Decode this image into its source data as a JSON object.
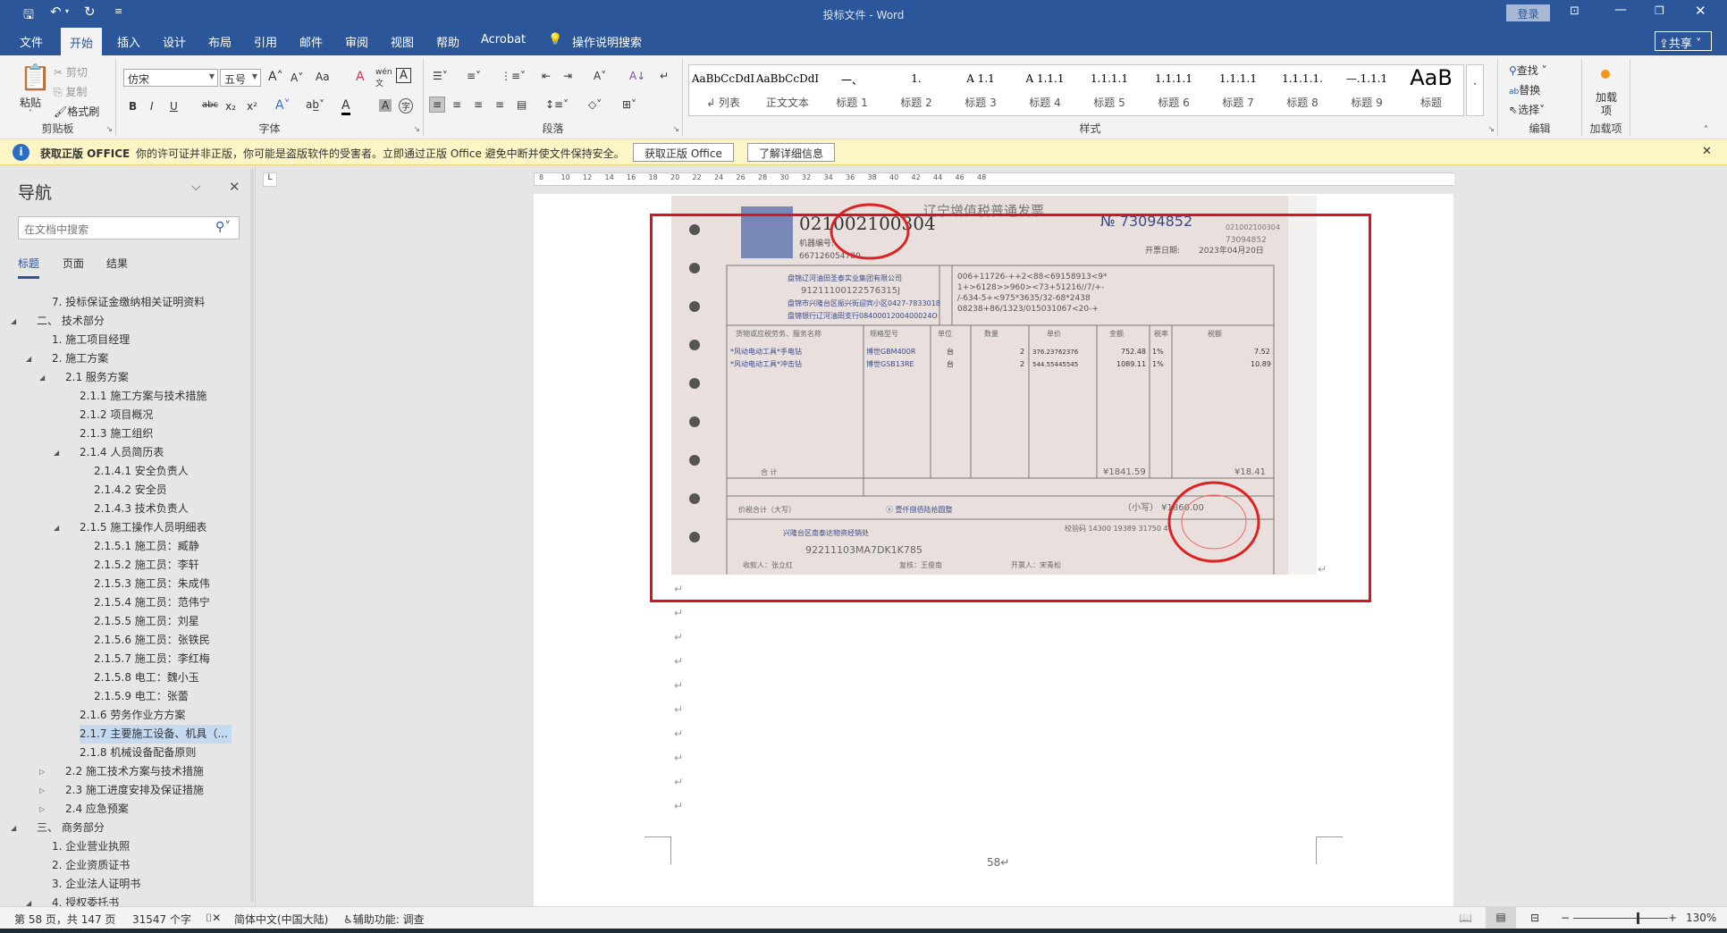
{
  "titlebar": {
    "title": "投标文件 - Word",
    "login": "登录",
    "qat": {
      "save": "save-icon",
      "undo": "undo-icon",
      "redo": "redo-icon",
      "customize": "customize-icon"
    }
  },
  "tabs": [
    "文件",
    "开始",
    "插入",
    "设计",
    "布局",
    "引用",
    "邮件",
    "审阅",
    "视图",
    "帮助",
    "Acrobat"
  ],
  "active_tab": "开始",
  "tell_me": "操作说明搜索",
  "share": "共享",
  "ribbon": {
    "clipboard": {
      "label": "剪贴板",
      "paste": "粘贴",
      "cut": "剪切",
      "copy": "复制",
      "format_painter": "格式刷"
    },
    "font": {
      "label": "字体",
      "font_name": "仿宋",
      "font_size": "五号",
      "case": "Aa",
      "bold": "B",
      "italic": "I",
      "underline": "U",
      "strike": "abc",
      "sub": "x₂",
      "sup": "x²"
    },
    "paragraph": {
      "label": "段落"
    },
    "styles": {
      "label": "样式",
      "items": [
        {
          "preview": "AaBbCcDdI",
          "name": "↲ 列表"
        },
        {
          "preview": "AaBbCcDdI",
          "name": "正文文本"
        },
        {
          "preview": "一、",
          "name": "标题 1"
        },
        {
          "preview": "1.",
          "name": "标题 2"
        },
        {
          "preview": "A 1.1",
          "name": "标题 3"
        },
        {
          "preview": "A 1.1.1",
          "name": "标题 4"
        },
        {
          "preview": "1.1.1.1",
          "name": "标题 5"
        },
        {
          "preview": "1.1.1.1",
          "name": "标题 6"
        },
        {
          "preview": "1.1.1.1",
          "name": "标题 7"
        },
        {
          "preview": "1.1.1.1.",
          "name": "标题 8"
        },
        {
          "preview": "—.1.1.1",
          "name": "标题 9"
        },
        {
          "preview": "AaB",
          "name": "标题"
        }
      ]
    },
    "editing": {
      "label": "编辑",
      "find": "查找",
      "replace": "替换",
      "select": "选择"
    },
    "addins": {
      "label": "加载项",
      "button": "加载项"
    }
  },
  "msgbar": {
    "title": "获取正版 OFFICE",
    "text": "你的许可证并非正版，你可能是盗版软件的受害者。立即通过正版 Office 避免中断并使文件保持安全。",
    "btn1": "获取正版 Office",
    "btn2": "了解详细信息"
  },
  "nav": {
    "title": "导航",
    "search_placeholder": "在文档中搜索",
    "tabs": [
      "标题",
      "页面",
      "结果"
    ],
    "items": [
      {
        "t": "7. 投标保证金缴纳相关证明资料",
        "l": 1,
        "e": ""
      },
      {
        "t": "二、 技术部分",
        "l": 0,
        "e": "open"
      },
      {
        "t": "1. 施工项目经理",
        "l": 1,
        "e": ""
      },
      {
        "t": "2. 施工方案",
        "l": 1,
        "e": "open"
      },
      {
        "t": "2.1 服务方案",
        "l": 2,
        "e": "open"
      },
      {
        "t": "2.1.1 施工方案与技术措施",
        "l": 3,
        "e": ""
      },
      {
        "t": "2.1.2 项目概况",
        "l": 3,
        "e": ""
      },
      {
        "t": "2.1.3 施工组织",
        "l": 3,
        "e": ""
      },
      {
        "t": "2.1.4 人员简历表",
        "l": 3,
        "e": "open"
      },
      {
        "t": "2.1.4.1 安全负责人",
        "l": 4,
        "e": ""
      },
      {
        "t": "2.1.4.2 安全员",
        "l": 4,
        "e": ""
      },
      {
        "t": "2.1.4.3 技术负责人",
        "l": 4,
        "e": ""
      },
      {
        "t": "2.1.5 施工操作人员明细表",
        "l": 3,
        "e": "open"
      },
      {
        "t": "2.1.5.1 施工员：臧静",
        "l": 4,
        "e": ""
      },
      {
        "t": "2.1.5.2 施工员：李轩",
        "l": 4,
        "e": ""
      },
      {
        "t": "2.1.5.3 施工员：朱成伟",
        "l": 4,
        "e": ""
      },
      {
        "t": "2.1.5.4 施工员：范伟宁",
        "l": 4,
        "e": ""
      },
      {
        "t": "2.1.5.5 施工员：刘星",
        "l": 4,
        "e": ""
      },
      {
        "t": "2.1.5.6 施工员：张铁民",
        "l": 4,
        "e": ""
      },
      {
        "t": "2.1.5.7 施工员：李红梅",
        "l": 4,
        "e": ""
      },
      {
        "t": "2.1.5.8 电工：魏小玉",
        "l": 4,
        "e": ""
      },
      {
        "t": "2.1.5.9 电工：张蕾",
        "l": 4,
        "e": ""
      },
      {
        "t": "2.1.6 劳务作业方方案",
        "l": 3,
        "e": ""
      },
      {
        "t": "2.1.7 主要施工设备、机具（...",
        "l": 3,
        "e": "",
        "sel": true
      },
      {
        "t": "2.1.8 机械设备配备原则",
        "l": 3,
        "e": ""
      },
      {
        "t": "2.2 施工技术方案与技术措施",
        "l": 2,
        "e": "closed"
      },
      {
        "t": "2.3 施工进度安排及保证措施",
        "l": 2,
        "e": "closed"
      },
      {
        "t": "2.4 应急预案",
        "l": 2,
        "e": "closed"
      },
      {
        "t": "三、 商务部分",
        "l": 0,
        "e": "open"
      },
      {
        "t": "1. 企业营业执照",
        "l": 1,
        "e": ""
      },
      {
        "t": "2. 企业资质证书",
        "l": 1,
        "e": ""
      },
      {
        "t": "3. 企业法人证明书",
        "l": 1,
        "e": ""
      },
      {
        "t": "4. 授权委托书",
        "l": 1,
        "e": "open"
      }
    ]
  },
  "invoice": {
    "code": "021002100304",
    "title": "辽宁增值税普通发票",
    "no": "№ 73094852",
    "code_small": "021002100304",
    "no_small": "73094852",
    "machine_label": "机器编号:",
    "machine_no": "667126054780",
    "date_label": "开票日期:",
    "date": "2023年04月20日",
    "buyer_name": "盘锦辽河油田圣泰实业集团有限公司",
    "buyer_tax": "91211100122576315J",
    "buyer_addr": "盘锦市兴隆台区振兴街迎宾小区0427-7833018",
    "buyer_bank": "盘锦银行辽河油田支行0840001200400024O",
    "cipher": [
      "006+11726-++2<88<69158913<9*",
      "1+>6128>>960><73+51216//7/+-",
      "/-634-5+<975*3635/32-68*2438",
      "08238+86/1323/015031067<20-+"
    ],
    "headers": [
      "货物或应税劳务、服务名称",
      "规格型号",
      "单位",
      "数量",
      "单价",
      "金额",
      "税率",
      "税额"
    ],
    "rows": [
      [
        "*风动电动工具*手电钻",
        "博世GBM400R",
        "台",
        "2",
        "376.23762376",
        "752.48",
        "1%",
        "7.52"
      ],
      [
        "*风动电动工具*冲击钻",
        "博世GSB13RE",
        "台",
        "2",
        "544.55445545",
        "1089.11",
        "1%",
        "10.89"
      ]
    ],
    "total_label": "合    计",
    "total_amount": "¥1841.59",
    "total_tax": "¥18.41",
    "grand_label": "价税合计（大写）",
    "grand_words": "ⓧ 壹仟捌佰陆拾圆整",
    "grand_small": "（小写） ¥1860.00",
    "seller_name": "兴隆台区南泰达物资经销处",
    "seller_tax": "92211103MA7DK1K785",
    "check_code": "校验码 14300 19389 31750 4",
    "payee": "收款人：张立红",
    "reviewer": "复核：王俊南",
    "drawer": "开票人：宋青松",
    "stamp": "兴隆台区南泰达物资经销处 发票专用章"
  },
  "page_number": "58↵",
  "status": {
    "page": "第 58 页，共 147 页",
    "words": "31547 个字",
    "lang": "简体中文(中国大陆)",
    "accessibility": "辅助功能: 调查",
    "zoom": "130%",
    "zoom_level": 130
  },
  "colors": {
    "accent": "#2b579a",
    "selection_box": "#d9141c",
    "msgbar": "#fcf5c5"
  }
}
